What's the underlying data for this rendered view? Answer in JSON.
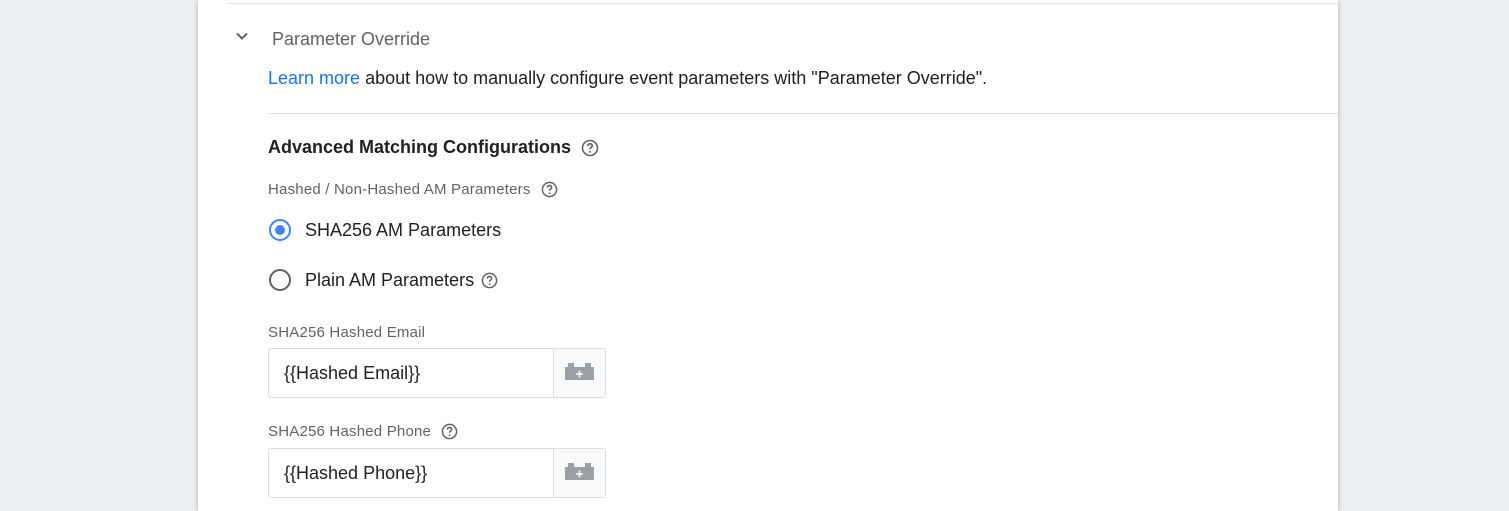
{
  "section": {
    "title": "Parameter Override",
    "expanded": true,
    "learn_more_link": "Learn more",
    "learn_more_text": " about how to manually configure event parameters with \"Parameter Override\"."
  },
  "advanced_matching": {
    "heading": "Advanced Matching Configurations",
    "hashed_label": "Hashed / Non-Hashed AM Parameters",
    "options": [
      {
        "label": "SHA256 AM Parameters",
        "selected": true
      },
      {
        "label": "Plain AM Parameters",
        "selected": false
      }
    ],
    "fields": [
      {
        "label": "SHA256 Hashed Email",
        "value": "{{Hashed Email}}"
      },
      {
        "label": "SHA256 Hashed Phone",
        "value": "{{Hashed Phone}}"
      }
    ]
  },
  "icons": {
    "chevron": "chevron-down-icon",
    "help": "help-circle-icon",
    "variable": "add-variable-icon"
  },
  "colors": {
    "accent": "#4285f4",
    "link": "#1a73e8",
    "background": "#eceff1"
  }
}
